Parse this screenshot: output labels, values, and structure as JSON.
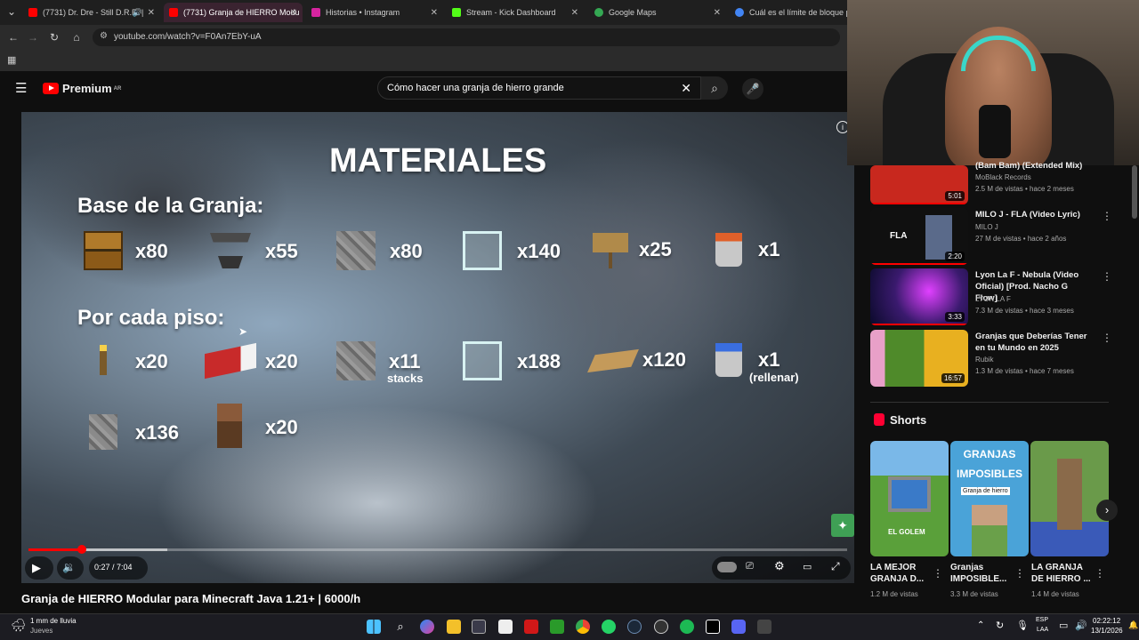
{
  "browser": {
    "tabs": [
      {
        "title": "(7731) Dr. Dre - Still D.R.E. |",
        "color": "#ff0000"
      },
      {
        "title": "(7731) Granja de HIERRO Modu",
        "color": "#ff0000",
        "active": true
      },
      {
        "title": "Historias • Instagram",
        "color": "#d6249f"
      },
      {
        "title": "Stream - Kick Dashboard",
        "color": "#53fc18"
      },
      {
        "title": "Google Maps",
        "color": "#34a853"
      },
      {
        "title": "Cuál es el límite de bloque para",
        "color": "#4285f4"
      }
    ],
    "url": "youtube.com/watch?v=F0An7EbY-uA"
  },
  "youtube": {
    "logo_text": "Premium",
    "region": "AR",
    "search_value": "Cómo hacer una granja de hierro grande",
    "video_title": "Granja de HIERRO Modular para Minecraft Java 1.21+ | 6000/h",
    "time": "0:27 / 7:04",
    "progress": 0.065,
    "buffered": 0.17
  },
  "video_frame": {
    "heading": "MATERIALES",
    "base_title": "Base de la Granja:",
    "floor_title": "Por cada piso:",
    "base_items": [
      {
        "icon": "chest-icon",
        "qty": "x80"
      },
      {
        "icon": "hopper-icon",
        "qty": "x55"
      },
      {
        "icon": "cobblestone-icon",
        "qty": "x80"
      },
      {
        "icon": "glass-icon",
        "qty": "x140"
      },
      {
        "icon": "sign-icon",
        "qty": "x25"
      },
      {
        "icon": "lava-bucket-icon",
        "qty": "x1"
      }
    ],
    "floor_items": [
      {
        "icon": "torch-icon",
        "qty": "x20"
      },
      {
        "icon": "bed-icon",
        "qty": "x20"
      },
      {
        "icon": "cobblestone-icon",
        "qty": "x11",
        "note": "stacks"
      },
      {
        "icon": "glass-icon",
        "qty": "x188"
      },
      {
        "icon": "slab-icon",
        "qty": "x120"
      },
      {
        "icon": "water-bucket-icon",
        "qty": "x1",
        "note": "(rellenar)"
      },
      {
        "icon": "cobblestone-wall-icon",
        "qty": "x136"
      },
      {
        "icon": "villager-icon",
        "qty": "x20"
      }
    ]
  },
  "sidebar": {
    "videos": [
      {
        "title": "(Bam Bam) (Extended Mix)",
        "channel": "MoBlack Records",
        "meta": "2.5 M de vistas • hace 2 meses",
        "duration": "5:01",
        "thumb": "#c8281e"
      },
      {
        "title": "MILO J - FLA (Video Lyric)",
        "channel": "MILO J",
        "meta": "27 M de vistas • hace 2 años",
        "duration": "2:20",
        "thumb": "#101010",
        "thumb_text": "FLA"
      },
      {
        "title": "Lyon La F - Nebula (Video Oficial) [Prod. Nacho G Flow]",
        "channel": "LYON LA F",
        "meta": "7.3 M de vistas • hace 3 meses",
        "duration": "3:33",
        "thumb": "#3a1a6e"
      },
      {
        "title": "Granjas que Deberías Tener en tu Mundo en 2025",
        "channel": "Rubik",
        "meta": "1.3 M de vistas • hace 7 meses",
        "duration": "16:57",
        "thumb": "#4f8a2a"
      }
    ],
    "shorts_heading": "Shorts",
    "shorts": [
      {
        "title": "LA MEJOR GRANJA D...",
        "views": "1.2 M de vistas",
        "thumb_text": "EL GOLEM",
        "thumb": "#5aa03a"
      },
      {
        "title": "Granjas IMPOSIBLE...",
        "views": "3.3 M de vistas",
        "thumb_text": "GRANJAS IMPOSIBLES",
        "thumb_sub": "Granja de hierro",
        "thumb": "#4aa3d8"
      },
      {
        "title": "LA GRANJA DE HIERRO ...",
        "views": "1.4 M de vistas",
        "thumb": "#4e7a34"
      }
    ]
  },
  "taskbar": {
    "weather": "1 mm de lluvia",
    "weather_sub": "Jueves",
    "lang": "ESP",
    "lang_sub": "LAA",
    "clock": "02:22:12",
    "date": "13/1/2026"
  }
}
